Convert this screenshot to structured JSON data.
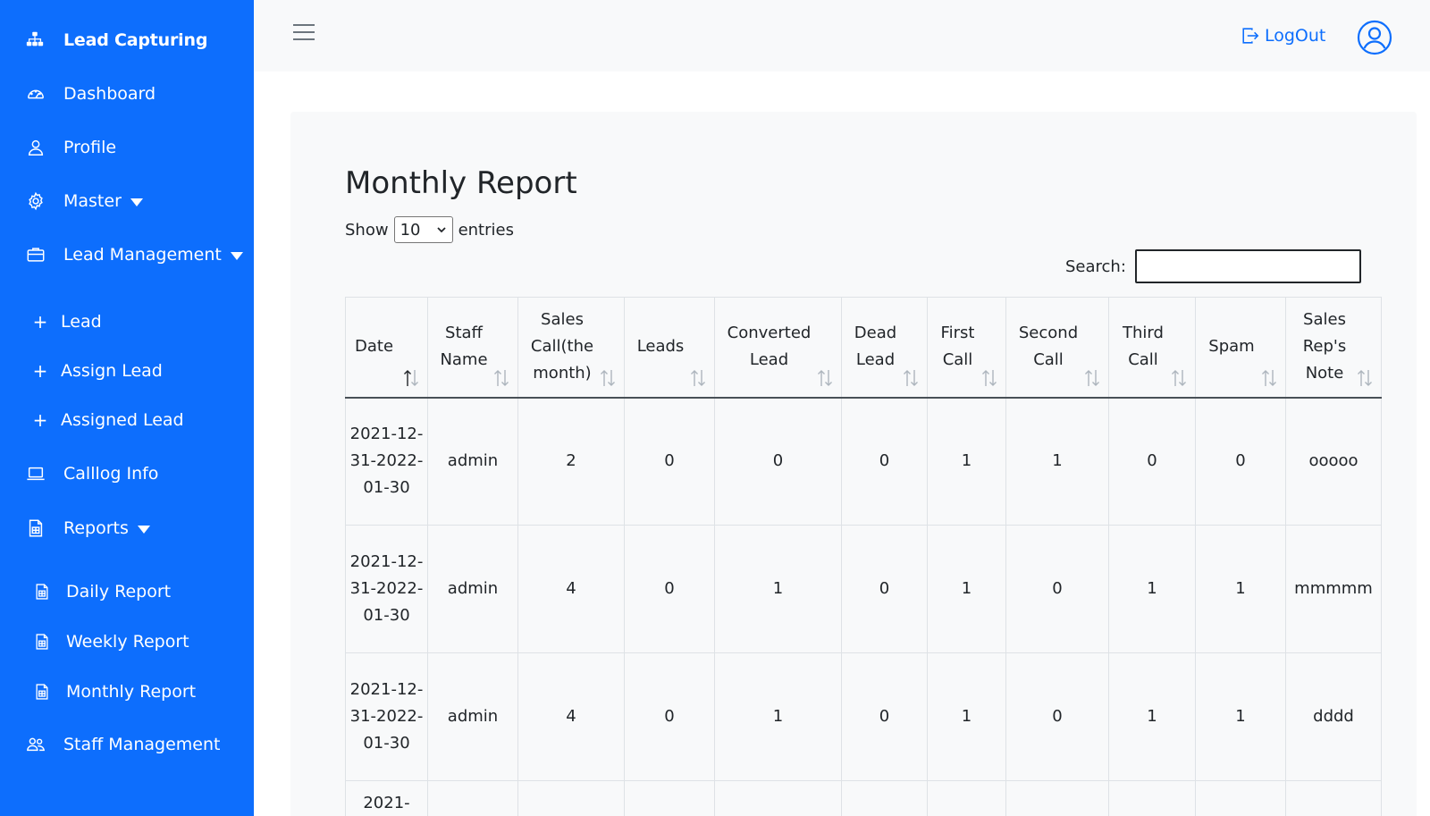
{
  "brand": {
    "title": "Lead Capturing",
    "icon": "sitemap-icon"
  },
  "sidebar": {
    "items": [
      {
        "label": "Dashboard",
        "icon": "gauge-icon"
      },
      {
        "label": "Profile",
        "icon": "user-icon"
      },
      {
        "label": "Master",
        "icon": "gear-icon",
        "has_caret": true
      },
      {
        "label": "Lead Management",
        "icon": "briefcase-icon",
        "has_caret": true
      },
      {
        "label": "Lead",
        "icon": "plus-icon"
      },
      {
        "label": "Assign Lead",
        "icon": "plus-icon"
      },
      {
        "label": "Assigned Lead",
        "icon": "plus-icon"
      },
      {
        "label": "Calllog Info",
        "icon": "laptop-icon"
      },
      {
        "label": "Reports",
        "icon": "report-icon",
        "has_caret": true
      },
      {
        "label": "Daily Report",
        "icon": "report-icon"
      },
      {
        "label": "Weekly Report",
        "icon": "report-icon"
      },
      {
        "label": "Monthly Report",
        "icon": "report-icon"
      },
      {
        "label": "Staff Management",
        "icon": "users-icon"
      }
    ]
  },
  "topbar": {
    "logout_label": "LogOut"
  },
  "page": {
    "title": "Monthly Report",
    "show_label": "Show",
    "entries_value": "10",
    "entries_label": "entries",
    "search_label": "Search:",
    "search_value": ""
  },
  "table": {
    "headers": [
      "Date",
      "Staff Name",
      "Sales Call(the month)",
      "Leads",
      "Converted Lead",
      "Dead Lead",
      "First Call",
      "Second Call",
      "Third Call",
      "Spam",
      "Sales Rep's Note"
    ],
    "rows": [
      [
        "2021-12-31-2022-01-30",
        "admin",
        "2",
        "0",
        "0",
        "0",
        "1",
        "1",
        "0",
        "0",
        "ooooo"
      ],
      [
        "2021-12-31-2022-01-30",
        "admin",
        "4",
        "0",
        "1",
        "0",
        "1",
        "0",
        "1",
        "1",
        "mmmmm"
      ],
      [
        "2021-12-31-2022-01-30",
        "admin",
        "4",
        "0",
        "1",
        "0",
        "1",
        "0",
        "1",
        "1",
        "dddd"
      ],
      [
        "2021-",
        "",
        "",
        "",
        "",
        "",
        "",
        "",
        "",
        "",
        ""
      ]
    ]
  },
  "colors": {
    "primary": "#0d6efd",
    "topbar": "#f8f9fa",
    "card": "#f8f9fa"
  }
}
